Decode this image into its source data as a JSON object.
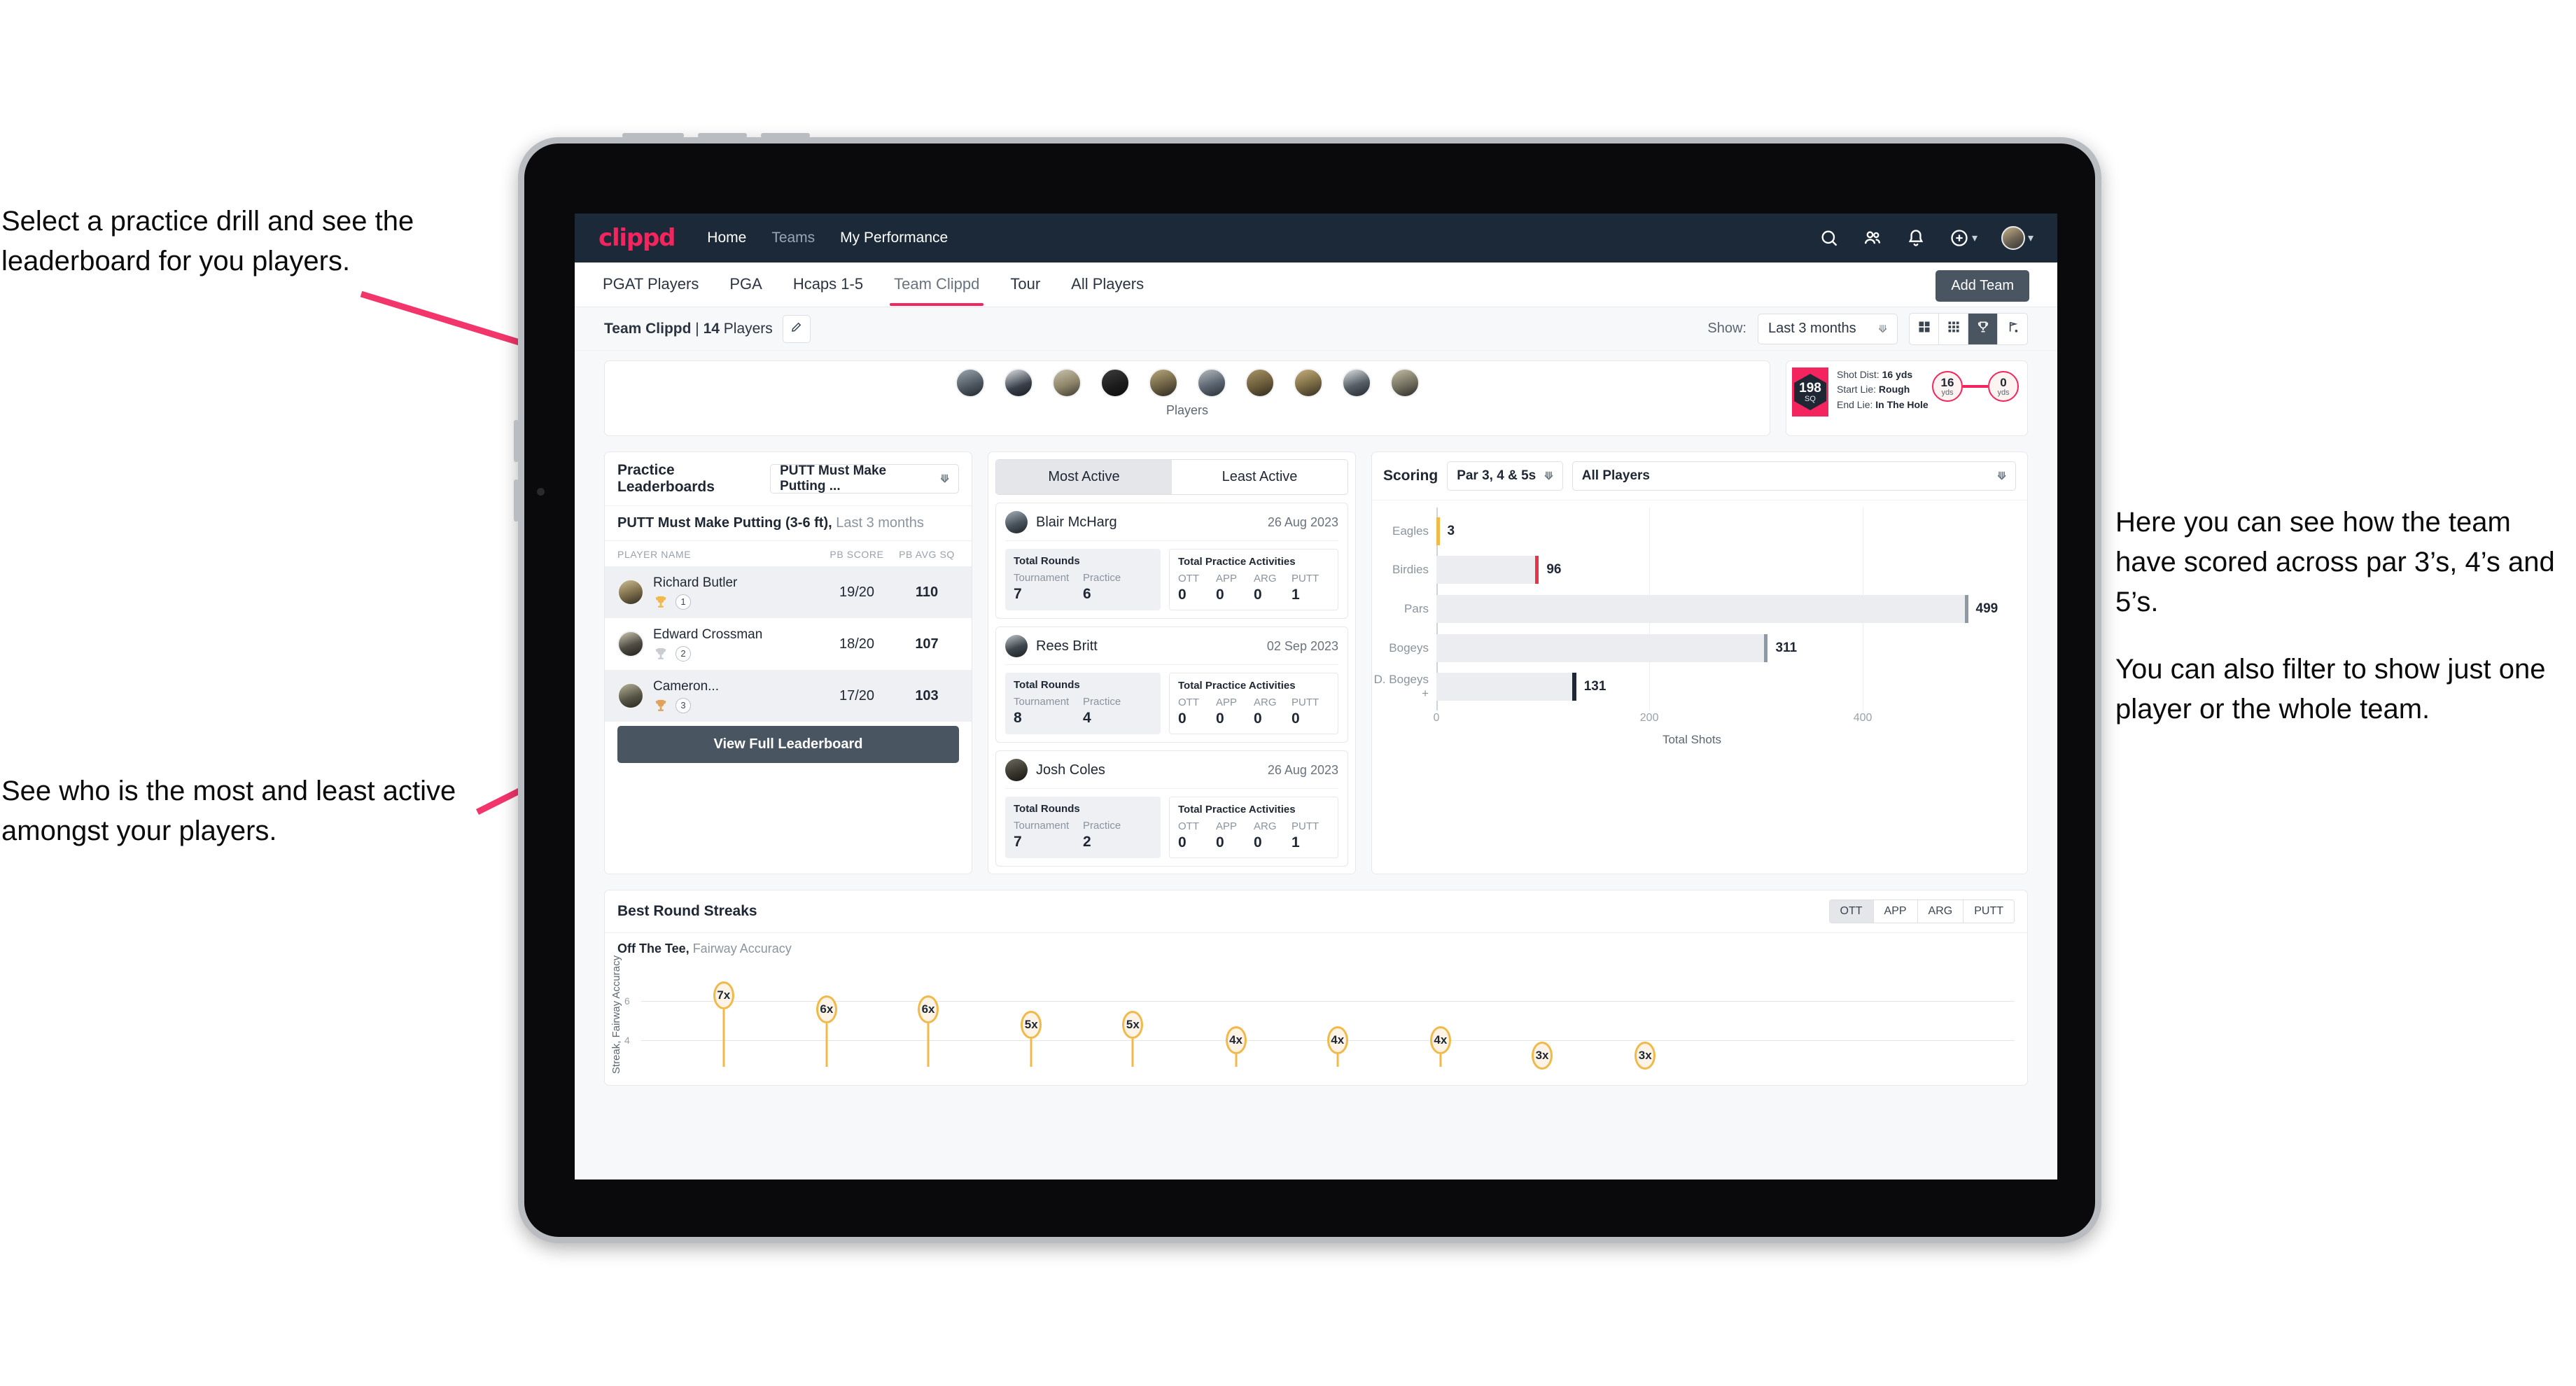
{
  "annotations": {
    "practice": "Select a practice drill and see the leaderboard for you players.",
    "activity": "See who is the most and least active amongst your players.",
    "scoring_1": "Here you can see how the team have scored across par 3’s, 4’s and 5’s.",
    "scoring_2": "You can also filter to show just one player or the whole team."
  },
  "colors": {
    "brand_pink": "#f4255e",
    "nav_dark": "#1b2938",
    "button_slate": "#4a5562",
    "streak_amber": "#f0b94a"
  },
  "topnav": {
    "brand": "clippd",
    "links": [
      {
        "label": "Home",
        "dim": false
      },
      {
        "label": "Teams",
        "dim": true
      },
      {
        "label": "My Performance",
        "dim": false
      }
    ],
    "icons": [
      "search-icon",
      "people-icon",
      "notifications-icon",
      "add-circle-icon",
      "account-avatar"
    ]
  },
  "tabs": {
    "items": [
      "PGAT Players",
      "PGA",
      "Hcaps 1-5",
      "Team Clippd",
      "Tour",
      "All Players"
    ],
    "active_index": 3,
    "add_team_label": "Add Team"
  },
  "subheader": {
    "team_name": "Team Clippd",
    "separator": " | ",
    "player_count": "14",
    "players_word": " Players",
    "show_label": "Show:",
    "range_value": "Last 3 months",
    "view_toggles": [
      "grid-large-icon",
      "grid-small-icon",
      "trophy-icon",
      "flag-icon"
    ],
    "active_toggle_index": 2
  },
  "players_card": {
    "caption": "Players",
    "avatar_count": 10
  },
  "shot_card": {
    "score": "198",
    "score_unit": "SQ",
    "lines": [
      {
        "key": "Shot Dist: ",
        "value": "16 yds"
      },
      {
        "key": "Start Lie: ",
        "value": "Rough"
      },
      {
        "key": "End Lie: ",
        "value": "In The Hole"
      }
    ],
    "start_dist": "16",
    "start_unit": "yds",
    "end_dist": "0",
    "end_unit": "yds"
  },
  "practice_leaderboard": {
    "title": "Practice Leaderboards",
    "drill_select": "PUTT Must Make Putting ...",
    "subtitle_bold": "PUTT Must Make Putting (3-6 ft),",
    "subtitle_rest": " Last 3 months",
    "columns": [
      "PLAYER NAME",
      "PB SCORE",
      "PB AVG SQ"
    ],
    "rows": [
      {
        "name": "Richard Butler",
        "rank": "1",
        "medal": "gold",
        "score": "19/20",
        "avg_sq": "110"
      },
      {
        "name": "Edward Crossman",
        "rank": "2",
        "medal": "silver",
        "score": "18/20",
        "avg_sq": "107"
      },
      {
        "name": "Cameron...",
        "rank": "3",
        "medal": "bronze",
        "score": "17/20",
        "avg_sq": "103"
      }
    ],
    "view_full_label": "View Full Leaderboard"
  },
  "activity": {
    "tabs": [
      "Most Active",
      "Least Active"
    ],
    "active_index": 0,
    "rounds_heading": "Total Rounds",
    "rounds_keys": [
      "Tournament",
      "Practice"
    ],
    "practice_heading": "Total Practice Activities",
    "practice_keys": [
      "OTT",
      "APP",
      "ARG",
      "PUTT"
    ],
    "items": [
      {
        "name": "Blair McHarg",
        "date": "26 Aug 2023",
        "rounds": [
          "7",
          "6"
        ],
        "practice": [
          "0",
          "0",
          "0",
          "1"
        ]
      },
      {
        "name": "Rees Britt",
        "date": "02 Sep 2023",
        "rounds": [
          "8",
          "4"
        ],
        "practice": [
          "0",
          "0",
          "0",
          "0"
        ]
      },
      {
        "name": "Josh Coles",
        "date": "26 Aug 2023",
        "rounds": [
          "7",
          "2"
        ],
        "practice": [
          "0",
          "0",
          "0",
          "1"
        ]
      }
    ]
  },
  "scoring": {
    "title": "Scoring",
    "par_filter": "Par 3, 4 & 5s",
    "player_filter": "All Players"
  },
  "streaks": {
    "title": "Best Round Streaks",
    "toggles": [
      "OTT",
      "APP",
      "ARG",
      "PUTT"
    ],
    "active_toggle_index": 0,
    "subtitle_bold": "Off The Tee,",
    "subtitle_rest": " Fairway Accuracy"
  },
  "chart_data": [
    {
      "type": "bar",
      "title": "Scoring",
      "orientation": "horizontal",
      "categories": [
        "Eagles",
        "Birdies",
        "Pars",
        "Bogeys",
        "D. Bogeys +"
      ],
      "values": [
        3,
        96,
        499,
        311,
        131
      ],
      "bar_cap_colors": [
        "#f0b94a",
        "#e8344a",
        "#8f99a4",
        "#8f99a4",
        "#1e2733"
      ],
      "xlabel": "Total Shots",
      "ylabel": "",
      "xlim": [
        0,
        540
      ],
      "xticks": [
        0,
        200,
        400
      ],
      "grid": true,
      "legend": "none"
    },
    {
      "type": "scatter",
      "title": "Best Round Streaks",
      "subtitle": "Off The Tee, Fairway Accuracy",
      "ylabel": "Streak, Fairway Accuracy",
      "xlabel": "",
      "ylim": [
        2,
        8
      ],
      "yticks": [
        4,
        6
      ],
      "grid": true,
      "legend": "none",
      "values": [
        7,
        6,
        6,
        5,
        5,
        4,
        4,
        4,
        3,
        3
      ],
      "labels": [
        "7x",
        "6x",
        "6x",
        "5x",
        "5x",
        "4x",
        "4x",
        "4x",
        "3x",
        "3x"
      ]
    }
  ]
}
